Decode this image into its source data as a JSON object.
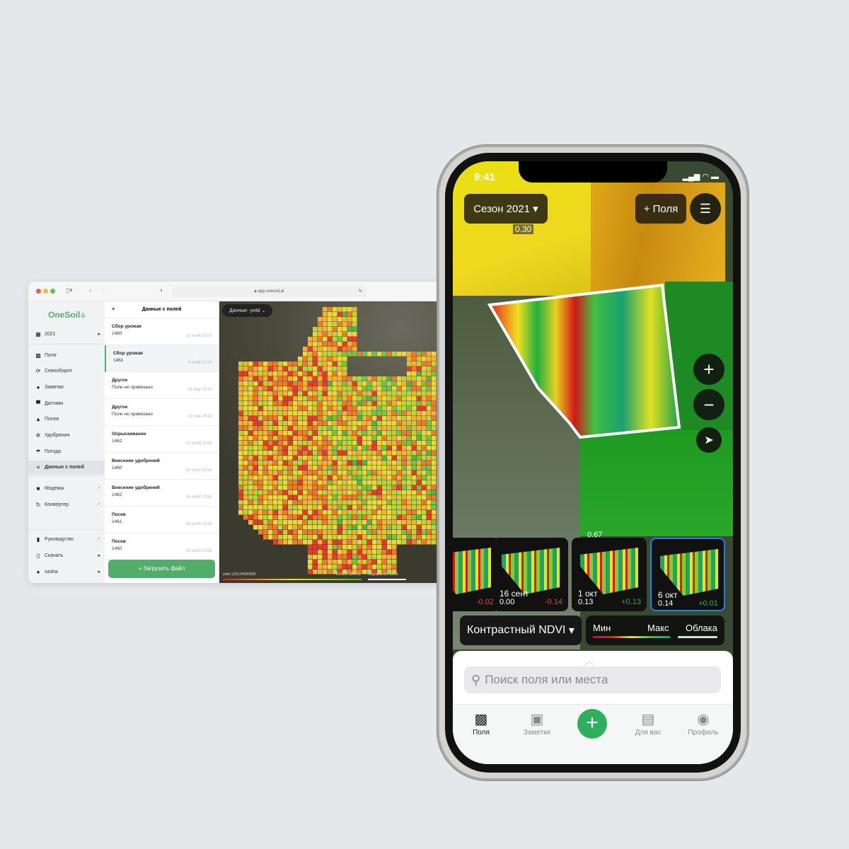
{
  "browser": {
    "url": "app.onesoil.ai",
    "logo": "OneSoil",
    "season": "2021",
    "sidebar": [
      {
        "label": "Поля",
        "icon": "fields-icon"
      },
      {
        "label": "Севооборот",
        "icon": "rotation-icon"
      },
      {
        "label": "Заметки",
        "icon": "pin-icon"
      },
      {
        "label": "Датчики",
        "icon": "sensor-icon"
      },
      {
        "label": "Посев",
        "icon": "seed-icon"
      },
      {
        "label": "Удобрения",
        "icon": "fertilizer-icon"
      },
      {
        "label": "Погода",
        "icon": "umbrella-icon"
      },
      {
        "label": "Данные с полей",
        "icon": "database-icon",
        "active": true
      }
    ],
    "sidebar_tools": [
      {
        "label": "Модемы"
      },
      {
        "label": "Конвертер"
      }
    ],
    "sidebar_bottom": [
      {
        "label": "Руководство"
      },
      {
        "label": "Скачать"
      },
      {
        "label": "sasha"
      }
    ],
    "list_title": "Данные с полей",
    "rows": [
      {
        "type": "Сбор урожая",
        "field": "1460",
        "date": "11 нояб 2019"
      },
      {
        "type": "Сбор урожая",
        "field": "1461",
        "date": "6 нояб 2019",
        "selected": true
      },
      {
        "type": "Другое",
        "field": "Поле не привязано",
        "date": "28 мар 2019"
      },
      {
        "type": "Другое",
        "field": "Поле не привязано",
        "date": "30 янв 2019"
      },
      {
        "type": "Опрыскивание",
        "field": "1462",
        "date": "21 нояб 2018"
      },
      {
        "type": "Внесение удобрений",
        "field": "1460",
        "date": "16 нояб 2018"
      },
      {
        "type": "Внесение удобрений",
        "field": "1462",
        "date": "16 нояб 2018"
      },
      {
        "type": "Посев",
        "field": "1461",
        "date": "16 нояб 2018"
      },
      {
        "type": "Посев",
        "field": "1460",
        "date": "16 нояб 2018"
      }
    ],
    "upload_label": "+ Загрузить файл",
    "data_select": "Данные: yeild",
    "legend_min": "yeild 1333,34000826",
    "legend_max": "8120,97184753",
    "coverage": "Недокрытие 100%"
  },
  "phone": {
    "time": "9:41",
    "season": "Сезон 2021",
    "add_fields": "+ Поля",
    "label_top": "0.30",
    "label_mid": "0.67",
    "thumbs": [
      {
        "date": "",
        "value": "",
        "delta": "-0.02",
        "delta_color": "#e0463c"
      },
      {
        "date": "16 сент",
        "value": "0.00",
        "delta": "-0.14",
        "delta_color": "#e0463c"
      },
      {
        "date": "1 окт",
        "value": "0.13",
        "delta": "+0.13",
        "delta_color": "#2fae5e"
      },
      {
        "date": "6 окт",
        "value": "0.14",
        "delta": "+0.01",
        "delta_color": "#2fae5e",
        "selected": true
      }
    ],
    "layer": "Контрастный NDVI",
    "legend_min": "Мин",
    "legend_max": "Макс",
    "legend_clouds": "Облака",
    "search_placeholder": "Поиск поля или места",
    "tabs": [
      {
        "label": "Поля",
        "active": true
      },
      {
        "label": "Заметки"
      },
      {
        "label": "Для вас"
      },
      {
        "label": "Профиль"
      }
    ],
    "accent": "#2fae5e"
  }
}
